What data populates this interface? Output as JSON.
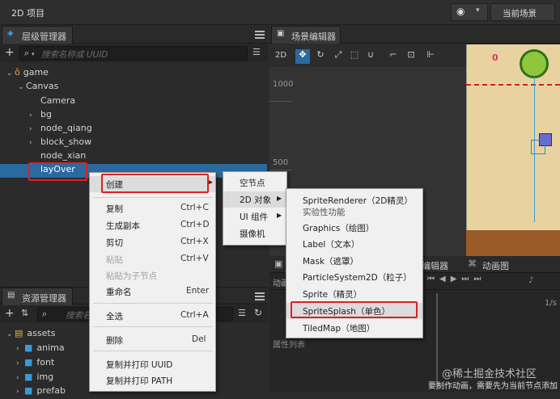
{
  "app": {
    "title": "2D 项目",
    "scene_button": "当前场景"
  },
  "hierarchy": {
    "tab": "层级管理器",
    "search_placeholder": "搜索名称或 UUID",
    "nodes": [
      {
        "label": "game",
        "caret": "⌄"
      },
      {
        "label": "Canvas",
        "caret": "⌄"
      },
      {
        "label": "Camera",
        "caret": ""
      },
      {
        "label": "bg",
        "caret": "›"
      },
      {
        "label": "node_qiang",
        "caret": "›"
      },
      {
        "label": "block_show",
        "caret": "›"
      },
      {
        "label": "node_xian",
        "caret": ""
      },
      {
        "label": "layOver",
        "caret": ""
      }
    ]
  },
  "scene": {
    "tab": "场景编辑器",
    "mode": "2D",
    "ruler": [
      "1000",
      "500"
    ],
    "timer": "0"
  },
  "assets": {
    "tab": "资源管理器",
    "search_placeholder": "搜索名",
    "items": [
      {
        "label": "assets",
        "caret": "⌄"
      },
      {
        "label": "anima",
        "caret": "›"
      },
      {
        "label": "font",
        "caret": "›"
      },
      {
        "label": "img",
        "caret": "›"
      },
      {
        "label": "prefab",
        "caret": "›"
      }
    ]
  },
  "context_menu": {
    "create": "创建",
    "items": [
      {
        "label": "复制",
        "shortcut": "Ctrl+C",
        "disabled": false
      },
      {
        "label": "生成副本",
        "shortcut": "Ctrl+D",
        "disabled": false
      },
      {
        "label": "剪切",
        "shortcut": "Ctrl+X",
        "disabled": false
      },
      {
        "label": "粘贴",
        "shortcut": "Ctrl+V",
        "disabled": true
      },
      {
        "label": "粘贴为子节点",
        "shortcut": "",
        "disabled": true
      },
      {
        "label": "重命名",
        "shortcut": "Enter",
        "disabled": false
      },
      {
        "label": "全选",
        "shortcut": "Ctrl+A",
        "disabled": false
      },
      {
        "label": "删除",
        "shortcut": "Del",
        "disabled": false
      },
      {
        "label": "复制并打印 UUID",
        "shortcut": "",
        "disabled": false
      },
      {
        "label": "复制并打印 PATH",
        "shortcut": "",
        "disabled": false
      }
    ]
  },
  "create_submenu": {
    "items": [
      "空节点",
      "2D 对象",
      "UI 组件",
      "摄像机"
    ]
  },
  "object_submenu": {
    "items": [
      {
        "label": "SpriteRenderer（2D精灵）",
        "sub": "实验性功能"
      },
      {
        "label": "Graphics（绘图）",
        "sub": ""
      },
      {
        "label": "Label（文本）",
        "sub": ""
      },
      {
        "label": "Mask（遮罩）",
        "sub": ""
      },
      {
        "label": "ParticleSystem2D（粒子）",
        "sub": ""
      },
      {
        "label": "Sprite（精灵）",
        "sub": ""
      },
      {
        "label": "SpriteSplash（单色）",
        "sub": ""
      },
      {
        "label": "TiledMap（地图）",
        "sub": ""
      }
    ]
  },
  "bottom": {
    "editor_tab": "编辑器",
    "anim_tab": "动画图",
    "anim_label": "动画",
    "prop_list": "属性列表",
    "zoom": "1/s",
    "hint": "要制作动画，需要先为当前节点添加"
  },
  "watermark": "@稀土掘金技术社区"
}
